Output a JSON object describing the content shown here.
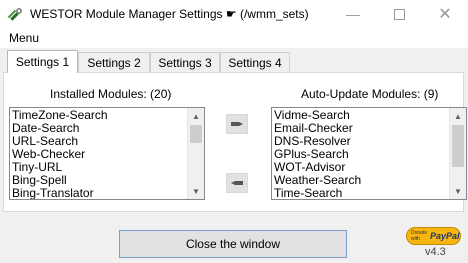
{
  "window": {
    "title": "WESTOR Module Manager Settings ☛ (/wmm_sets)",
    "app_icon": "wrench-screwdriver-icon",
    "controls": [
      "minimize-icon",
      "maximize-icon",
      "close-icon"
    ]
  },
  "menu": {
    "label": "Menu"
  },
  "tabs": [
    {
      "label": "Settings 1",
      "active": true
    },
    {
      "label": "Settings 2",
      "active": false
    },
    {
      "label": "Settings 3",
      "active": false
    },
    {
      "label": "Settings 4",
      "active": false
    }
  ],
  "installed": {
    "label": "Installed Modules: (20)",
    "items": [
      "TimeZone-Search",
      "Date-Search",
      "URL-Search",
      "Web-Checker",
      "Tiny-URL",
      "Bing-Spell",
      "Bing-Translator"
    ]
  },
  "auto_update": {
    "label": "Auto-Update Modules: (9)",
    "items": [
      "Vidme-Search",
      "Email-Checker",
      "DNS-Resolver",
      "GPlus-Search",
      "WOT-Advisor",
      "Weather-Search",
      "Time-Search"
    ]
  },
  "move_buttons": {
    "right_icon": "hand-pointing-right-icon",
    "left_icon": "hand-pointing-left-icon"
  },
  "close_button": {
    "label": "Close the window"
  },
  "donate": {
    "line1": "Donate",
    "line2": "with",
    "brand": "PayPal"
  },
  "version": "v4.3",
  "colors": {
    "tab_active_bg": "#ffffff",
    "button_focus_border": "#7a9ec7",
    "paypal_yellow": "#f7b60f"
  }
}
